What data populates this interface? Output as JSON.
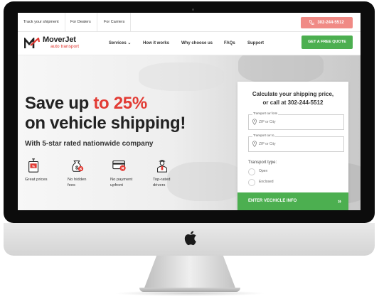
{
  "topbar": {
    "links": [
      "Track your shipment",
      "For Dealers",
      "For Carriers"
    ],
    "phone": "302-244-5512"
  },
  "brand": {
    "name_prefix": "Mover",
    "name_suffix": "Jet",
    "tagline": "auto transport"
  },
  "nav": {
    "items": [
      "Services",
      "How it works",
      "Why choose us",
      "FAQs",
      "Support"
    ],
    "cta": "GET A FREE QUOTE"
  },
  "hero": {
    "headline_part1": "Save up ",
    "headline_highlight": "to 25%",
    "headline_line2": "on vehicle shipping!",
    "subheadline": "With 5-star rated nationwide company",
    "features": [
      {
        "label": "Great prices",
        "icon": "price-tag-icon"
      },
      {
        "label": "No hidden\nfees",
        "icon": "money-bag-icon"
      },
      {
        "label": "No payment\nupfront",
        "icon": "no-card-icon"
      },
      {
        "label": "Top-rated\ndrivers",
        "icon": "driver-icon"
      }
    ]
  },
  "form": {
    "title_line1": "Calculate your shipping price,",
    "title_line2": "or call at 302-244-5512",
    "from_label": "Transport car form",
    "from_placeholder": "ZIP or City",
    "to_label": "Transport car to",
    "to_placeholder": "ZIP or City",
    "transport_type_label": "Transport type:",
    "options": [
      "Open",
      "Enclosed"
    ],
    "submit_label": "ENTER VECHICLE INFO",
    "submit_arrow": "»"
  },
  "colors": {
    "accent_red": "#e23b34",
    "phone_button": "#f08a85",
    "cta_green": "#4caf50"
  }
}
